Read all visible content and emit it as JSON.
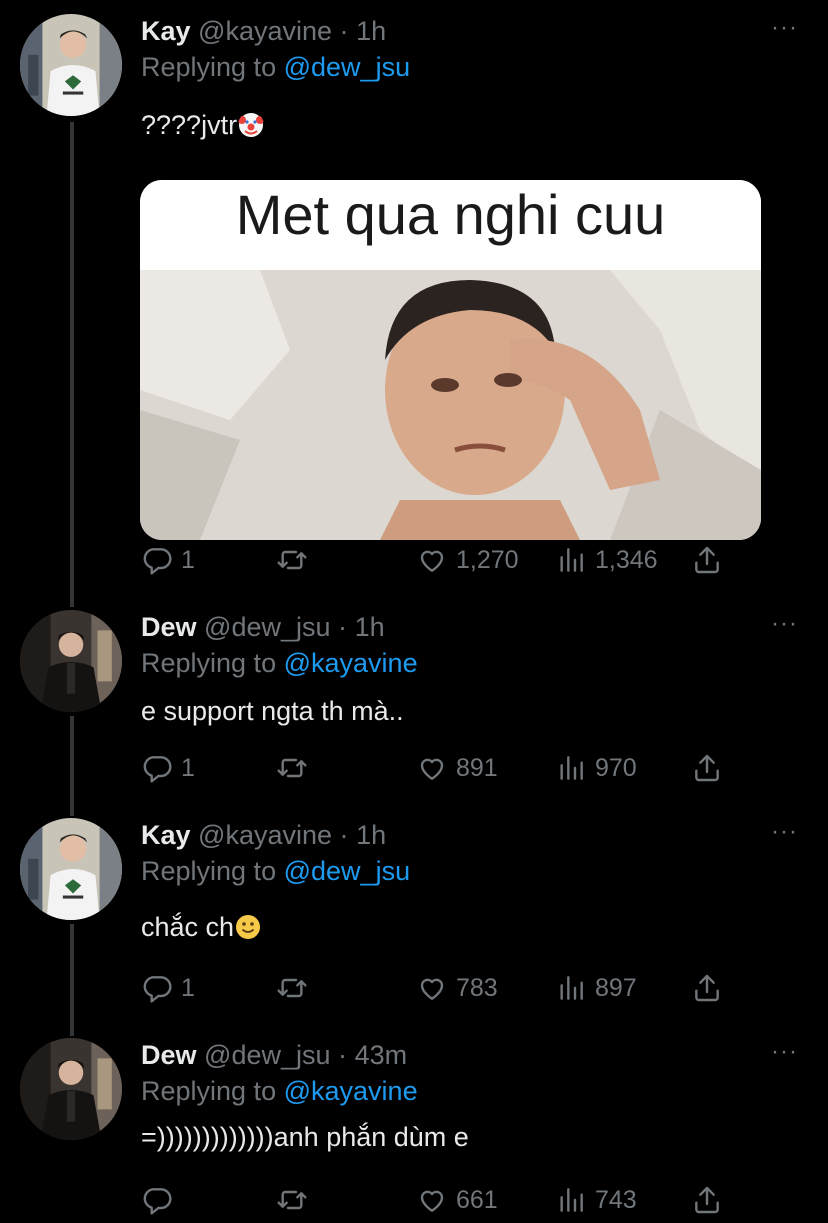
{
  "tweets": [
    {
      "name": "Kay",
      "handle": "@kayavine",
      "dot": "·",
      "time": "1h",
      "replying_prefix": "Replying to",
      "replying_to": "@dew_jsu",
      "text": "????jvtr",
      "text_emoji": "clown-face",
      "media_caption": "Met qua nghi cuu",
      "replies": "1",
      "retweets": "",
      "likes": "1,270",
      "views": "1,346",
      "more": "···"
    },
    {
      "name": "Dew",
      "handle": "@dew_jsu",
      "dot": "·",
      "time": "1h",
      "replying_prefix": "Replying to",
      "replying_to": "@kayavine",
      "text": "e support ngta th mà..",
      "replies": "1",
      "retweets": "",
      "likes": "891",
      "views": "970",
      "more": "···"
    },
    {
      "name": "Kay",
      "handle": "@kayavine",
      "dot": "·",
      "time": "1h",
      "replying_prefix": "Replying to",
      "replying_to": "@dew_jsu",
      "text": "chắc ch",
      "text_emoji": "slightly-smiling-face",
      "replies": "1",
      "retweets": "",
      "likes": "783",
      "views": "897",
      "more": "···"
    },
    {
      "name": "Dew",
      "handle": "@dew_jsu",
      "dot": "·",
      "time": "43m",
      "replying_prefix": "Replying to",
      "replying_to": "@kayavine",
      "text": "=)))))))))))))anh phắn dùm e",
      "replies": "",
      "retweets": "",
      "likes": "661",
      "views": "743",
      "more": "···"
    }
  ],
  "icons": {
    "reply": "reply-icon",
    "retweet": "retweet-icon",
    "like": "heart-icon",
    "views": "views-icon",
    "share": "share-icon"
  },
  "colors": {
    "background": "#000000",
    "text": "#e7e9ea",
    "secondary": "#71767b",
    "mention": "#1d9bf0",
    "thread_line": "#333639"
  }
}
